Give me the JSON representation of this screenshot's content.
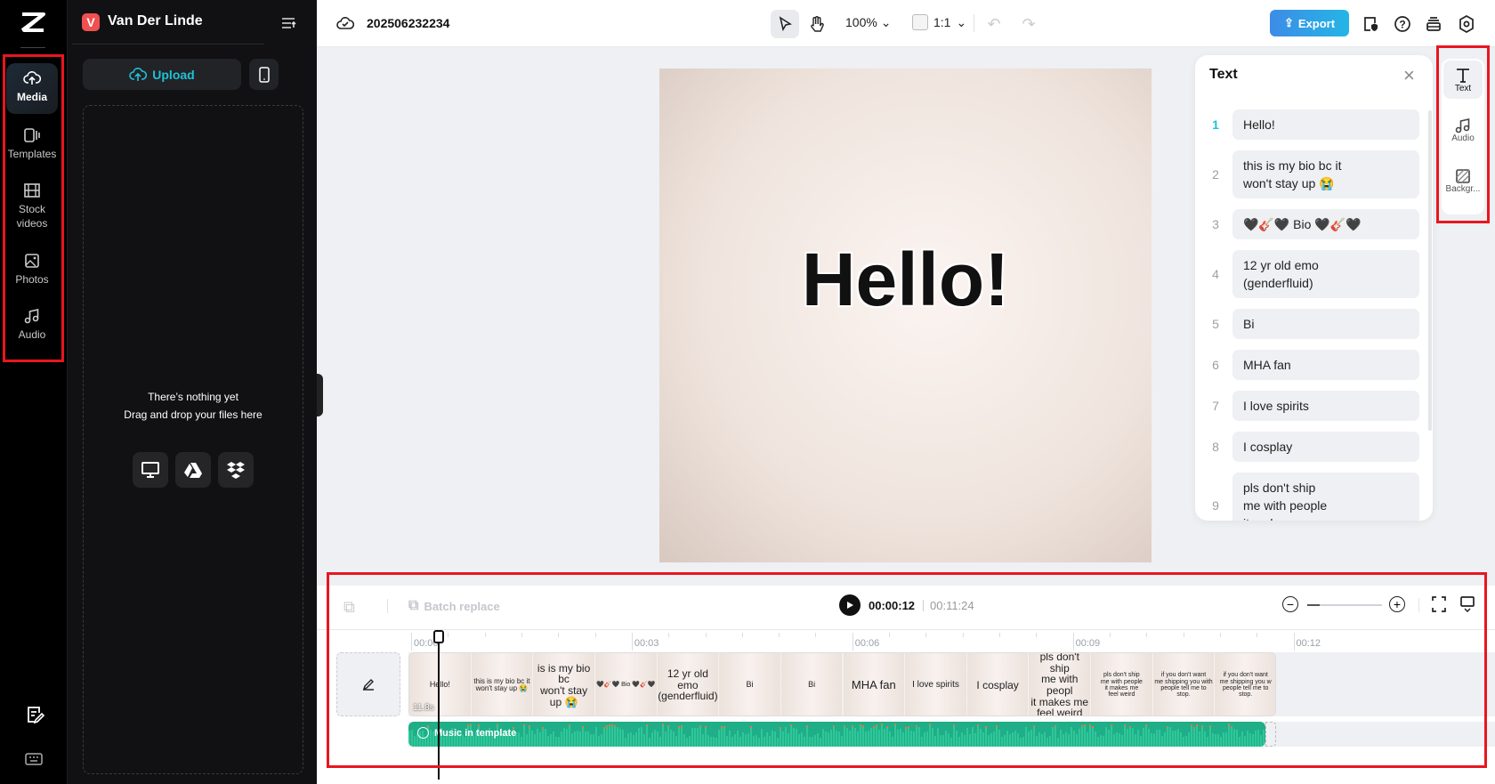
{
  "rail": {
    "items": [
      {
        "label": "Media",
        "icon": "cloud-upload-icon"
      },
      {
        "label": "Templates",
        "icon": "templates-icon"
      },
      {
        "label": "Stock videos",
        "icon": "film-icon"
      },
      {
        "label": "Photos",
        "icon": "image-icon"
      },
      {
        "label": "Audio",
        "icon": "music-icon"
      }
    ]
  },
  "media": {
    "workspace_initial": "V",
    "workspace_name": "Van Der Linde",
    "upload_label": "Upload",
    "empty_title": "There’s nothing yet",
    "empty_subtitle": "Drag and drop your files here"
  },
  "topbar": {
    "project_name": "202506232234",
    "zoom": "100%",
    "ratio": "1:1",
    "export_label": "Export"
  },
  "canvas": {
    "text": "Hello!"
  },
  "text_panel": {
    "title": "Text",
    "items": [
      {
        "num": "1",
        "text": "Hello!"
      },
      {
        "num": "2",
        "text": "this is my bio bc it\nwon't stay up 😭"
      },
      {
        "num": "3",
        "text": "🖤🎸🖤 Bio 🖤🎸🖤"
      },
      {
        "num": "4",
        "text": "12 yr old emo\n(genderfluid)"
      },
      {
        "num": "5",
        "text": "Bi"
      },
      {
        "num": "6",
        "text": "MHA fan"
      },
      {
        "num": "7",
        "text": "I love spirits"
      },
      {
        "num": "8",
        "text": "I cosplay"
      },
      {
        "num": "9",
        "text": "pls don't ship\nme with people\nit makes me"
      }
    ]
  },
  "right_rail": {
    "items": [
      {
        "label": "Text"
      },
      {
        "label": "Audio"
      },
      {
        "label": "Backgr..."
      }
    ]
  },
  "timeline": {
    "batch_replace": "Batch replace",
    "current_time": "00:00:12",
    "total_time": "00:11:24",
    "ruler": [
      "00:00",
      "00:03",
      "00:06",
      "00:09",
      "00:12"
    ],
    "duration": "11.8s",
    "audio_label": "Music in template",
    "frames": [
      "Hello!",
      "this is my bio bc it\nwon't stay up 😭",
      "is is my bio bc\nwon't stay up 😭",
      "🖤🎸🖤 Bio 🖤🎸🖤",
      "12 yr old emo\n(genderfluid)",
      "Bi",
      "Bi",
      "MHA fan",
      "I love spirits",
      "I cosplay",
      "pls don't ship\nme with peopl\nit makes me\nfeel weird",
      "pls don't ship\nme with people\nit makes me\nfeel weird",
      "if you don't want\nme shipping you with\npeople tell me to\nstop.",
      "if you don't want\nme shipping you w\npeople tell me to\nstop."
    ],
    "frame_sizes": [
      9,
      8,
      12,
      7,
      12,
      9,
      9,
      13,
      10,
      12,
      12,
      7,
      7,
      7
    ],
    "playhead_seconds": 0.36,
    "clip_seconds": 11.8
  },
  "colors": {
    "accent": "#1fc2d6",
    "export": "#2f9bea",
    "audio": "#1fae87",
    "annotation": "#e8161f"
  }
}
